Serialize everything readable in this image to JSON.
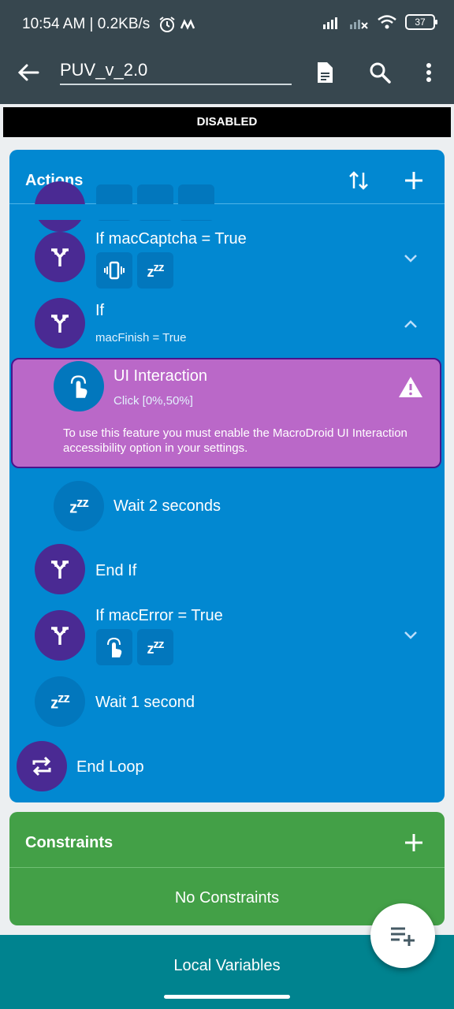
{
  "status_bar": {
    "time": "10:54 AM | 0.2KB/s",
    "battery": "37"
  },
  "app_bar": {
    "title": "PUV_v_2.0"
  },
  "banner": {
    "text": "DISABLED"
  },
  "actions": {
    "title": "Actions",
    "items": [
      {
        "title": "If macCaptcha = True"
      },
      {
        "title": "If",
        "subtitle": "macFinish = True"
      },
      {
        "title": "UI Interaction",
        "subtitle": "Click [0%,50%]",
        "warning": "To use this feature you must enable the MacroDroid UI Interaction accessibility option in your settings."
      },
      {
        "title": "Wait 2 seconds"
      },
      {
        "title": "End If"
      },
      {
        "title": "If macError = True"
      },
      {
        "title": "Wait 1 second"
      },
      {
        "title": "End Loop"
      }
    ]
  },
  "constraints": {
    "title": "Constraints",
    "empty_text": "No Constraints"
  },
  "local_variables": {
    "label": "Local Variables"
  },
  "colors": {
    "actions": "#0288d1",
    "constraints": "#43a047",
    "highlight": "#ba68c8",
    "icon_circle": "#4a2a93",
    "topbar": "#37474f"
  }
}
